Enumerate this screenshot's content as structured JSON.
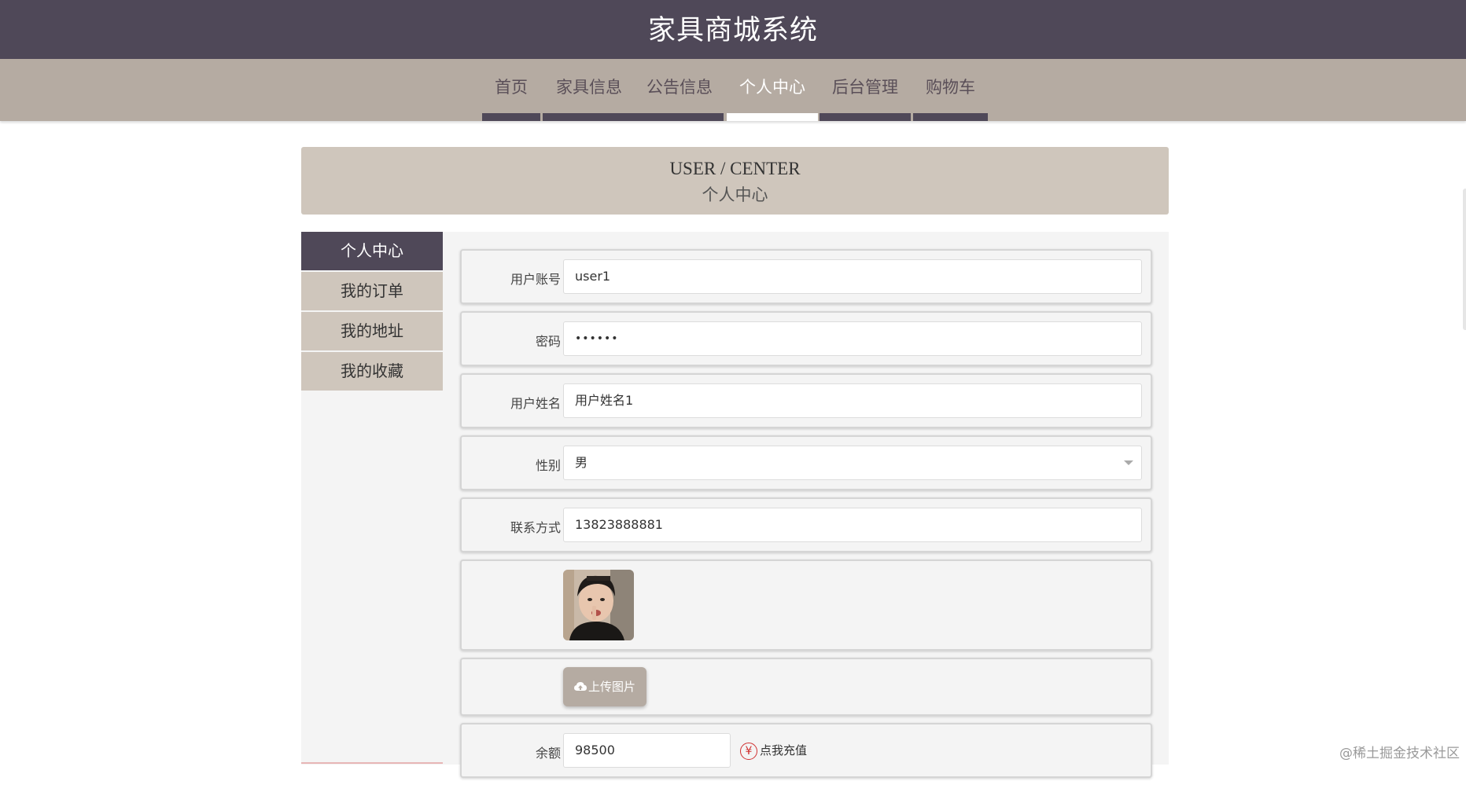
{
  "header": {
    "title": "家具商城系统"
  },
  "nav": {
    "items": [
      {
        "label": "首页"
      },
      {
        "label": "家具信息"
      },
      {
        "label": "公告信息"
      },
      {
        "label": "个人中心"
      },
      {
        "label": "后台管理"
      },
      {
        "label": "购物车"
      }
    ],
    "active": "个人中心"
  },
  "hero": {
    "title_en": "USER / CENTER",
    "title_cn": "个人中心"
  },
  "sidebar": {
    "items": [
      {
        "label": "个人中心"
      },
      {
        "label": "我的订单"
      },
      {
        "label": "我的地址"
      },
      {
        "label": "我的收藏"
      }
    ],
    "active": "个人中心"
  },
  "form": {
    "username": {
      "label": "用户账号",
      "value": "user1"
    },
    "password": {
      "label": "密码",
      "value": "••••••"
    },
    "realname": {
      "label": "用户姓名",
      "value": "用户姓名1"
    },
    "gender": {
      "label": "性别",
      "value": "男"
    },
    "phone": {
      "label": "联系方式",
      "value": "13823888881"
    },
    "upload": {
      "label": "上传图片"
    },
    "balance": {
      "label": "余额",
      "value": "98500",
      "recharge_label": "点我充值",
      "recharge_icon": "yen-icon"
    }
  },
  "watermark": "@稀土掘金技术社区",
  "colors": {
    "primary_dark": "#4f4858",
    "nav_bg": "#b5aba2",
    "hero_bg": "#cfc6bc",
    "panel_bg": "#f4f4f4",
    "accent_red": "#d03030"
  }
}
